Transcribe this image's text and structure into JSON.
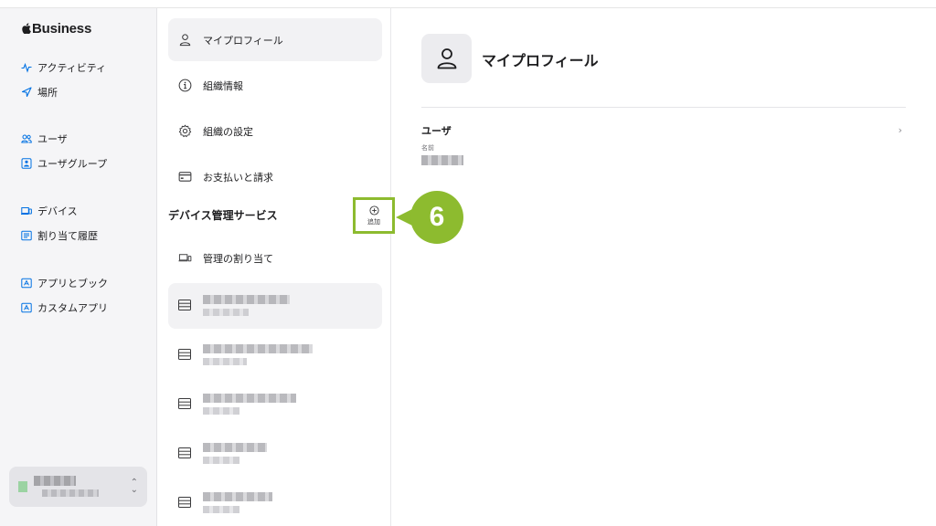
{
  "brand": {
    "name": "Business"
  },
  "sidebar": {
    "items": [
      {
        "label": "アクティビティ",
        "icon": "activity-icon"
      },
      {
        "label": "場所",
        "icon": "location-arrow-icon"
      },
      {
        "label": "ユーザ",
        "icon": "users-icon"
      },
      {
        "label": "ユーザグループ",
        "icon": "user-group-icon"
      },
      {
        "label": "デバイス",
        "icon": "devices-icon"
      },
      {
        "label": "割り当て履歴",
        "icon": "assignment-history-icon"
      },
      {
        "label": "アプリとブック",
        "icon": "apps-books-icon"
      },
      {
        "label": "カスタムアプリ",
        "icon": "custom-apps-icon"
      }
    ]
  },
  "middle": {
    "items": [
      {
        "label": "マイプロフィール",
        "icon": "person-icon"
      },
      {
        "label": "組織情報",
        "icon": "info-icon"
      },
      {
        "label": "組織の設定",
        "icon": "gear-icon"
      },
      {
        "label": "お支払いと請求",
        "icon": "credit-card-icon"
      }
    ],
    "section_title": "デバイス管理サービス",
    "add_label": "追加",
    "assignment_label": "管理の割り当て"
  },
  "callout": {
    "number": "6"
  },
  "main": {
    "title": "マイプロフィール",
    "user_heading": "ユーザ",
    "name_label": "名前"
  },
  "colors": {
    "accent_green": "#8dbb2f",
    "sidebar_bg": "#f5f5f7",
    "selected_bg": "#f2f2f4"
  }
}
